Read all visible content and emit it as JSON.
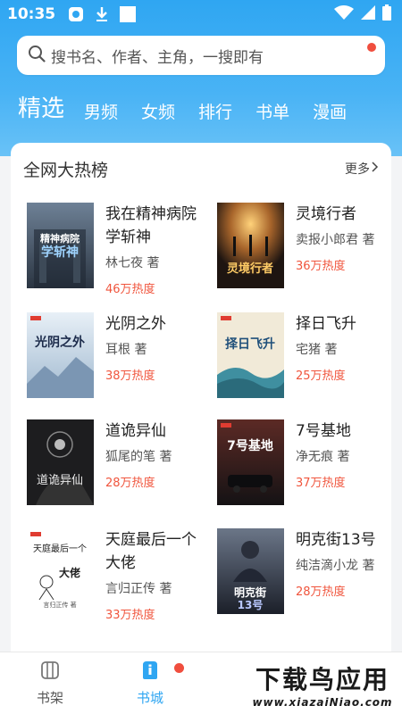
{
  "status_bar": {
    "time": "10:35"
  },
  "search": {
    "placeholder": "搜书名、作者、主角，一搜即有"
  },
  "tabs": [
    {
      "label": "精选",
      "active": true
    },
    {
      "label": "男频"
    },
    {
      "label": "女频"
    },
    {
      "label": "排行"
    },
    {
      "label": "书单"
    },
    {
      "label": "漫画"
    }
  ],
  "section": {
    "title": "全网大热榜",
    "more": "更多"
  },
  "books": [
    {
      "title": "我在精神病院学斩神",
      "author": "林七夜 著",
      "heat": "46万热度",
      "cover_title": "我在精神病院学斩神",
      "cover_bg": "#3b4a5c"
    },
    {
      "title": "灵境行者",
      "author": "卖报小郎君 著",
      "heat": "36万热度",
      "cover_title": "灵境行者",
      "cover_bg": "#2a1f1a"
    },
    {
      "title": "光阴之外",
      "author": "耳根 著",
      "heat": "38万热度",
      "cover_title": "光阴之外",
      "cover_bg": "#cfe0ee"
    },
    {
      "title": "择日飞升",
      "author": "宅猪 著",
      "heat": "25万热度",
      "cover_title": "择日飞升",
      "cover_bg": "#e9e2cf"
    },
    {
      "title": "道诡异仙",
      "author": "狐尾的笔 著",
      "heat": "28万热度",
      "cover_title": "道诡异仙",
      "cover_bg": "#1d1d1f"
    },
    {
      "title": "7号基地",
      "author": "净无痕 著",
      "heat": "37万热度",
      "cover_title": "7号基地",
      "cover_bg": "#231c1c"
    },
    {
      "title": "天庭最后一个大佬",
      "author": "言归正传 著",
      "heat": "33万热度",
      "cover_title": "天庭最后一个大佬",
      "cover_bg": "#ffffff"
    },
    {
      "title": "明克街13号",
      "author": "纯洁滴小龙 著",
      "heat": "28万热度",
      "cover_title": "明克街13号",
      "cover_bg": "#242a36"
    }
  ],
  "bottom_nav": [
    {
      "label": "书架",
      "icon": "bookshelf-icon",
      "active": false
    },
    {
      "label": "书城",
      "icon": "bookstore-icon",
      "active": true
    }
  ],
  "watermark": {
    "main": "下载鸟应用",
    "sub": "www.xiazaiNiao.com"
  },
  "colors": {
    "accent": "#2fa6f2",
    "heat": "#f0553d",
    "badge": "#f04e3e"
  }
}
